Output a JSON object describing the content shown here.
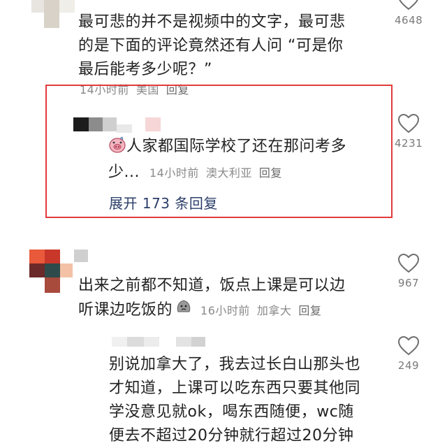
{
  "comments": [
    {
      "text_line1": "最可悲的并不是视频中的文字，最可悲",
      "text_line2": "的是下面的评论竟然还有人问 “可是你",
      "text_line3": "最后能考多少呢？”",
      "time": "14小时前",
      "location": "美国",
      "reply_label": "回复",
      "likes": "4648"
    },
    {
      "text_line1": "人家都国际学校了还在那问考多",
      "text_line2": "少...",
      "time": "14小时前",
      "location": "澳大利亚",
      "reply_label": "回复",
      "likes": "4231",
      "expand_label": "展开 173 条回复",
      "emoji_icon": "pig-face-icon"
    },
    {
      "text_line1": "出来之前都不知道，饭点上课是可以边",
      "text_line2": "听课边吃饭的",
      "time": "16小时前",
      "location": "加拿大",
      "reply_label": "回复",
      "likes": "967",
      "emoji_icon": "sad-face-icon"
    },
    {
      "text_line1": "别说加拿大了，我去过长白山那头也",
      "text_line2": "才知道，上课可以吃东西只要其他同",
      "text_line3": "学没意见就ok，喝东西随便，wc随",
      "text_line4": "便去不超过20分钟就行超过20分钟",
      "likes": "249"
    }
  ],
  "colors": {
    "highlight_border": "#e23b3b",
    "expand_text": "#2b3e6a",
    "meta_text": "#8a8a8a"
  }
}
